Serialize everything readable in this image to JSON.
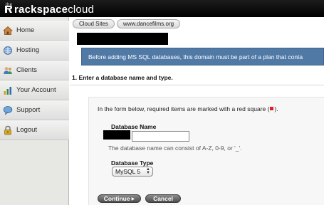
{
  "brand": {
    "prefix": "the",
    "name_bold": "rackspace",
    "name_light": "cloud"
  },
  "sidebar": {
    "items": [
      {
        "label": "Home",
        "icon": "home-icon"
      },
      {
        "label": "Hosting",
        "icon": "hosting-icon"
      },
      {
        "label": "Clients",
        "icon": "clients-icon"
      },
      {
        "label": "Your Account",
        "icon": "account-icon"
      },
      {
        "label": "Support",
        "icon": "support-icon"
      },
      {
        "label": "Logout",
        "icon": "lock-icon"
      }
    ]
  },
  "breadcrumb": {
    "items": [
      "Cloud Sites",
      "www.dancefilms.org"
    ]
  },
  "notice": {
    "text": "Before adding MS SQL databases, this domain must be part of a plan that conta"
  },
  "step": {
    "title": "1. Enter a database name and type."
  },
  "form": {
    "intro_before": "In the form below, required items are marked with a red square (",
    "intro_after": ").",
    "db_name_label": "Database Name",
    "db_name_value": "",
    "db_name_hint": "The database name can consist of A-Z, 0-9, or '_'.",
    "db_type_label": "Database Type",
    "db_type_selected": "MySQL 5",
    "continue_label": "Continue",
    "cancel_label": "Cancel"
  },
  "colors": {
    "notice_bg": "#5079a6",
    "required_marker": "#dd2222",
    "topbar": "#000000"
  }
}
